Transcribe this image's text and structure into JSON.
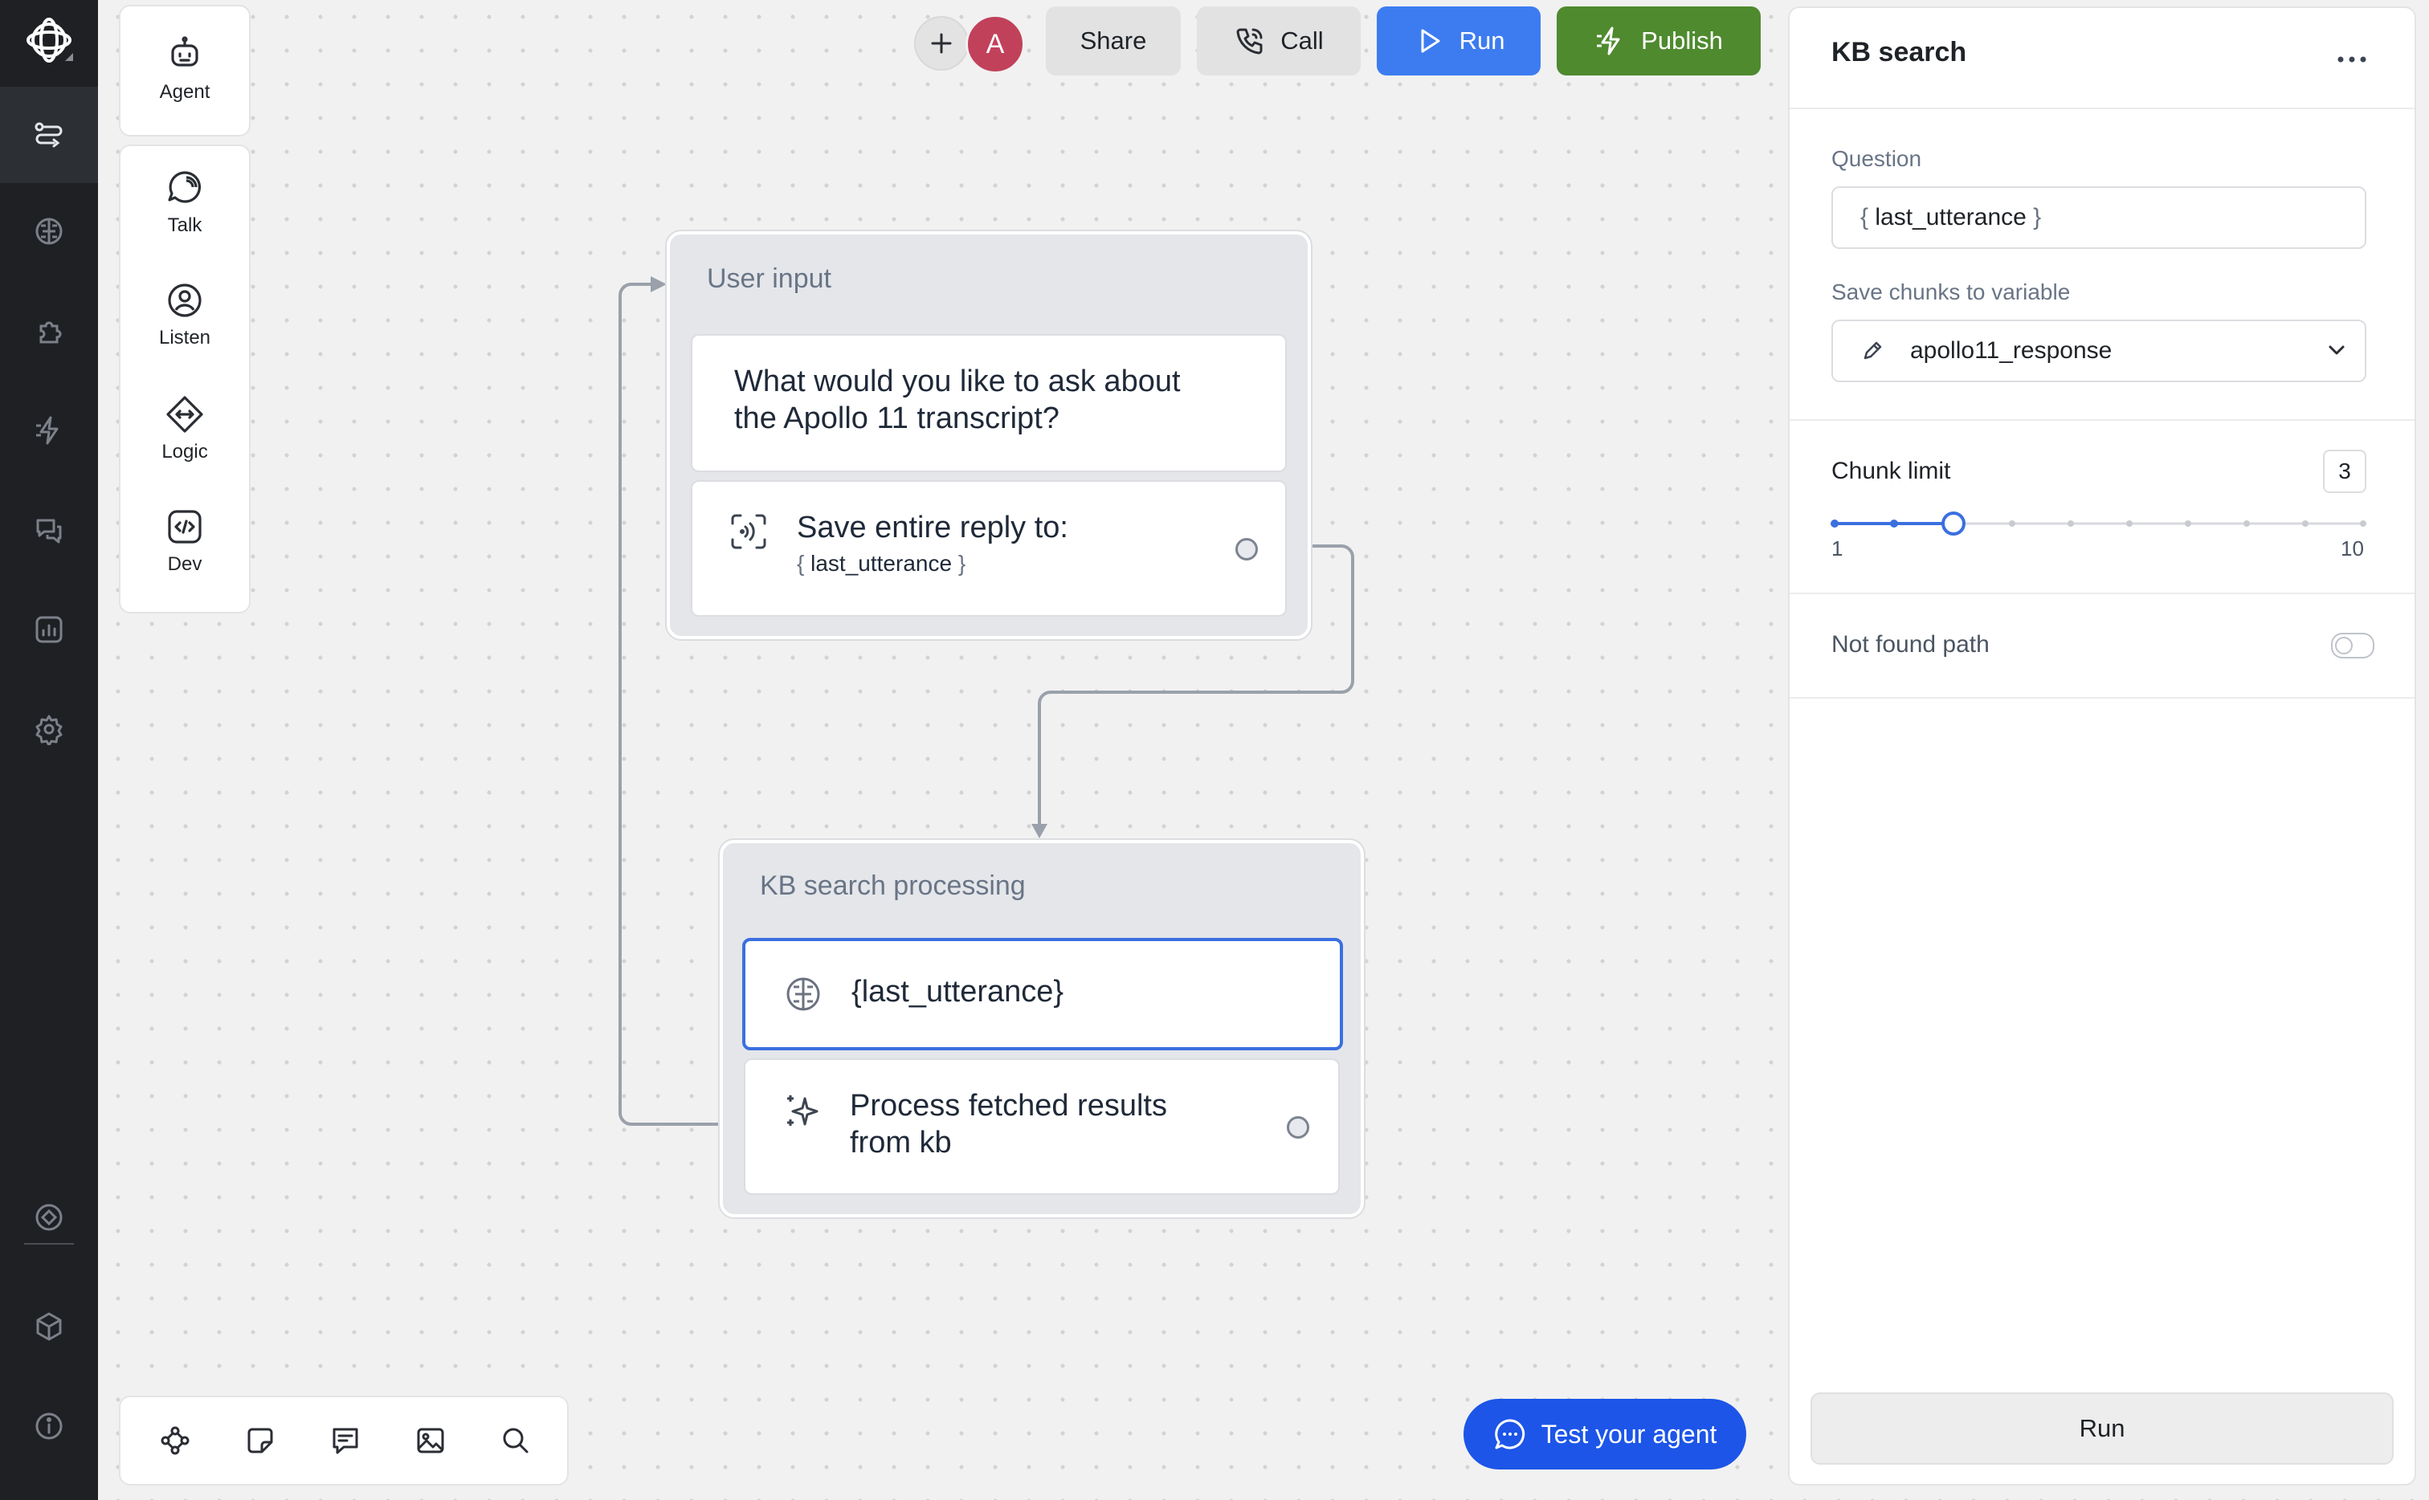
{
  "palette": {
    "top": [
      {
        "label": "Agent",
        "icon": "robot-icon"
      }
    ],
    "items": [
      {
        "label": "Talk",
        "icon": "speech-bubble-icon"
      },
      {
        "label": "Listen",
        "icon": "listen-icon"
      },
      {
        "label": "Logic",
        "icon": "logic-diamond-icon"
      },
      {
        "label": "Dev",
        "icon": "code-icon"
      }
    ]
  },
  "toolbar": {
    "avatar_initial": "A",
    "share_label": "Share",
    "call_label": "Call",
    "run_label": "Run",
    "publish_label": "Publish",
    "colors": {
      "run": "#3d7cf0",
      "publish": "#4f8a2e"
    }
  },
  "canvas": {
    "user_input": {
      "title": "User input",
      "prompt_line1": "What would you like to ask about",
      "prompt_line2": "the Apollo 11 transcript?",
      "save_label": "Save entire reply to:",
      "save_var": "last_utterance"
    },
    "kb_node": {
      "title": "KB search processing",
      "query": "{last_utterance}",
      "process_line1": "Process fetched results",
      "process_line2": "from kb"
    }
  },
  "test_button": {
    "label": "Test your agent"
  },
  "panel": {
    "title": "KB search",
    "question_label": "Question",
    "question_value": "last_utterance",
    "save_chunks_label": "Save chunks to variable",
    "save_chunks_value": "apollo11_response",
    "chunk_limit_label": "Chunk limit",
    "chunk_limit_value": "3",
    "slider_min": "1",
    "slider_max": "10",
    "not_found_label": "Not found path",
    "not_found_enabled": false,
    "run_label": "Run"
  }
}
